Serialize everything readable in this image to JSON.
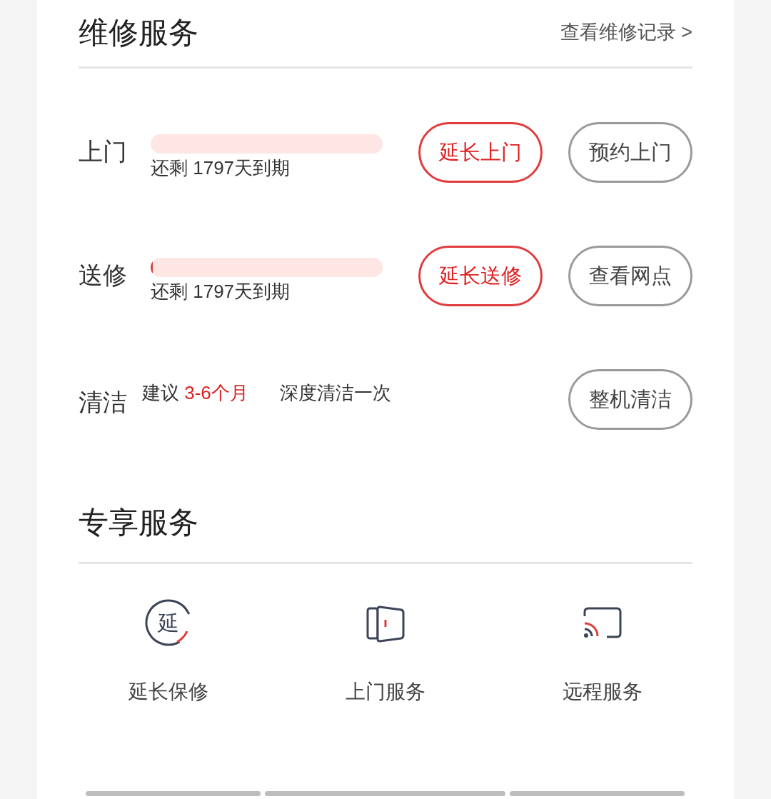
{
  "repair_section": {
    "title": "维修服务",
    "link": "查看维修记录 >"
  },
  "services": [
    {
      "kind": "warranty",
      "label": "上门",
      "level": 0,
      "remaining": "还剩 1797天到期",
      "buttons": [
        {
          "label": "延长上门",
          "primary": true
        },
        {
          "label": "预约上门",
          "primary": false
        }
      ]
    },
    {
      "kind": "warranty",
      "label": "送修",
      "level": 0.01,
      "remaining": "还剩 1797天到期",
      "buttons": [
        {
          "label": "延长送修",
          "primary": true
        },
        {
          "label": "查看网点",
          "primary": false
        }
      ]
    },
    {
      "kind": "advice",
      "label": "清洁",
      "advice_prefix": "建议",
      "advice_period": "3-6个月",
      "advice_suffix": "深度清洁一次",
      "buttons": [
        {
          "label": "整机清洁",
          "primary": false
        }
      ]
    }
  ],
  "exclusive_section": {
    "title": "专享服务"
  },
  "exclusive_items": [
    {
      "kind": "extend",
      "icon_text": "延",
      "label": "延长保修"
    },
    {
      "kind": "door",
      "label": "上门服务"
    },
    {
      "kind": "remote",
      "label": "远程服务"
    }
  ]
}
